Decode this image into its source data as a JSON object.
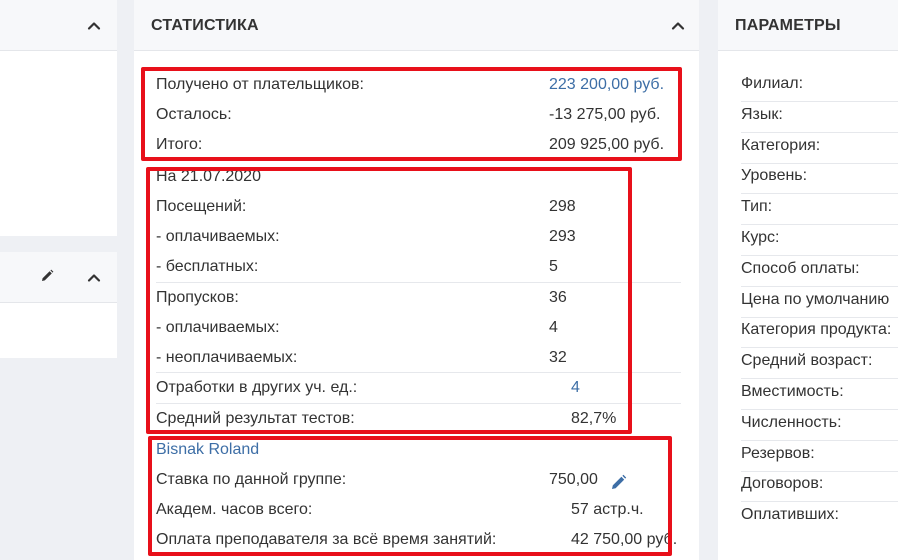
{
  "stats_panel": {
    "title": "СТАТИСТИКА",
    "payments": [
      {
        "label": "Получено от плательщиков:",
        "value": "223 200,00 руб."
      },
      {
        "label": "Осталось:",
        "value": "-13 275,00 руб."
      },
      {
        "label": "Итого:",
        "value": "209 925,00 руб."
      }
    ],
    "attendance": {
      "date_label": "На 21.07.2020",
      "rows": [
        {
          "label": "Посещений:",
          "value": "298"
        },
        {
          "label": "- оплачиваемых:",
          "value": "293"
        },
        {
          "label": "- бесплатных:",
          "value": "5"
        },
        {
          "label": "Пропусков:",
          "value": "36"
        },
        {
          "label": "- оплачиваемых:",
          "value": "4"
        },
        {
          "label": "- неоплачиваемых:",
          "value": "32"
        },
        {
          "label": "Отработки в других уч. ед.:",
          "value": "4"
        },
        {
          "label": "Средний результат тестов:",
          "value": "82,7%"
        }
      ]
    },
    "teacher": {
      "name": "Bisnak Roland",
      "rows": [
        {
          "label": "Ставка по данной группе:",
          "value": "750,00"
        },
        {
          "label": "Академ. часов всего:",
          "value": "57 астр.ч."
        },
        {
          "label": "Оплата преподавателя за всё время занятий:",
          "value": "42 750,00 руб."
        }
      ]
    }
  },
  "params_panel": {
    "title": "ПАРАМЕТРЫ",
    "items": [
      "Филиал:",
      "Язык:",
      "Категория:",
      "Уровень:",
      "Тип:",
      "Курс:",
      "Способ оплаты:",
      "Цена по умолчанию",
      "Категория продукта:",
      "Средний возраст:",
      "Вместимость:",
      "Численность:",
      "Резервов:",
      "Договоров:",
      "Оплативших:"
    ]
  },
  "colors": {
    "link": "#3d6ea6",
    "highlight_box": "#e8101a",
    "panel_header_bg": "#f7f8fa",
    "page_bg": "#eef0f4"
  }
}
